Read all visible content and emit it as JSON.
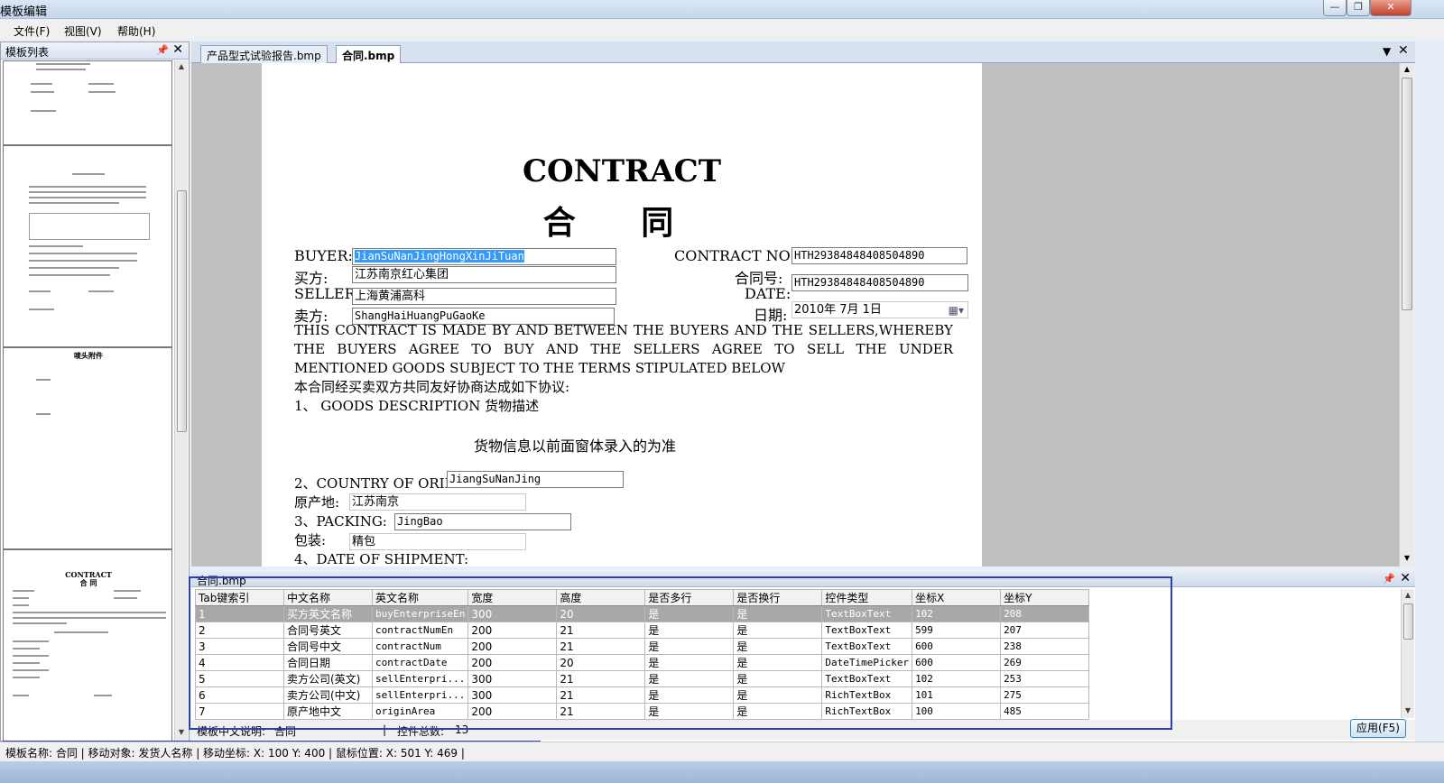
{
  "window": {
    "title": "模板编辑"
  },
  "menu": [
    "文件(F)",
    "视图(V)",
    "帮助(H)"
  ],
  "left_panel": {
    "title": "模板列表"
  },
  "tabs": [
    {
      "label": "产品型式试验报告.bmp",
      "active": false
    },
    {
      "label": "合同.bmp",
      "active": true
    }
  ],
  "contract": {
    "title_en": "CONTRACT",
    "title_cn": "合 同",
    "buyer_label": "BUYER:",
    "buyer_value": "JianSuNanJingHongXinJiTuan",
    "buyer_cn_label": "买方:",
    "buyer_cn_value": "江苏南京红心集团",
    "seller_label": "SELLER:",
    "seller_value": "上海黄浦高科",
    "seller_cn_label": "卖方:",
    "seller_cn_value": "ShangHaiHuangPuGaoKe",
    "contract_no_label": "CONTRACT NO:",
    "contract_no_value": "HTH29384848408504890",
    "contract_no_cn_label": "合同号:",
    "contract_no_cn_value": "HTH29384848408504890",
    "date_label": "DATE:",
    "date_cn_label": "日期:",
    "date_value": "2010年 7月 1日",
    "paragraph": "THIS CONTRACT IS MADE BY AND BETWEEN THE BUYERS AND THE SELLERS,WHEREBY THE BUYERS AGREE TO BUY AND THE SELLERS AGREE TO SELL THE UNDER MENTIONED GOODS SUBJECT TO THE TERMS STIPULATED BELOW",
    "paragraph_cn": "本合同经买卖双方共同友好协商达成如下协议:",
    "goods_desc": "1、 GOODS DESCRIPTION  货物描述",
    "goods_note": "货物信息以前面窗体录入的为准",
    "country_label": "2、COUNTRY OF ORING:",
    "country_value": "JiangSuNanJing",
    "origin_label": "原产地:",
    "origin_value": "江苏南京",
    "packing_label": "3、PACKING:",
    "packing_value": "JingBao",
    "packing_cn_label": "包装:",
    "packing_cn_value": "精包",
    "shipment_label": "4、DATE OF SHIPMENT:"
  },
  "thumbs": {
    "t3_title": "唛头附件"
  },
  "grid": {
    "panel_title": "合同.bmp",
    "columns": [
      "Tab键索引",
      "中文名称",
      "英文名称",
      "宽度",
      "高度",
      "是否多行",
      "是否换行",
      "控件类型",
      "坐标X",
      "坐标Y"
    ],
    "rows": [
      [
        "1",
        "买方英文名称",
        "buyEnterpriseEn",
        "300",
        "20",
        "是",
        "是",
        "TextBoxText",
        "102",
        "208"
      ],
      [
        "2",
        "合同号英文",
        "contractNumEn",
        "200",
        "21",
        "是",
        "是",
        "TextBoxText",
        "599",
        "207"
      ],
      [
        "3",
        "合同号中文",
        "contractNum",
        "200",
        "21",
        "是",
        "是",
        "TextBoxText",
        "600",
        "238"
      ],
      [
        "4",
        "合同日期",
        "contractDate",
        "200",
        "20",
        "是",
        "是",
        "DateTimePicker",
        "600",
        "269"
      ],
      [
        "5",
        "卖方公司(英文)",
        "sellEnterpri...",
        "300",
        "21",
        "是",
        "是",
        "TextBoxText",
        "102",
        "253"
      ],
      [
        "6",
        "卖方公司(中文)",
        "sellEnterpri...",
        "300",
        "21",
        "是",
        "是",
        "RichTextBox",
        "101",
        "275"
      ],
      [
        "7",
        "原产地中文",
        "originArea",
        "200",
        "21",
        "是",
        "是",
        "RichTextBox",
        "100",
        "485"
      ]
    ],
    "footer_desc_label": "模板中文说明:",
    "footer_desc_value": "合同",
    "footer_count_label": "控件总数:",
    "footer_count_value": "13",
    "apply_label": "应用(F5)"
  },
  "status": {
    "text": "模板名称: 合同 | 移动对象: 发货人名称 | 移动坐标: X: 100 Y: 400 | 鼠标位置: X: 501 Y: 469 |"
  }
}
